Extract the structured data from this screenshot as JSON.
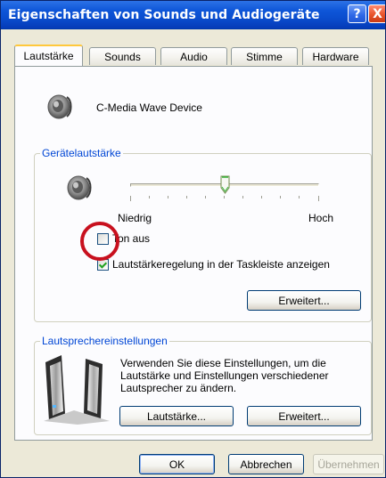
{
  "window": {
    "title": "Eigenschaften von Sounds und Audiogeräte",
    "help_symbol": "?",
    "close_symbol": "X"
  },
  "tabs": [
    {
      "label": "Lautstärke",
      "selected": true
    },
    {
      "label": "Sounds",
      "selected": false
    },
    {
      "label": "Audio",
      "selected": false
    },
    {
      "label": "Stimme",
      "selected": false
    },
    {
      "label": "Hardware",
      "selected": false
    }
  ],
  "device": {
    "name": "C-Media Wave Device",
    "icon": "speaker-icon"
  },
  "device_volume": {
    "group_label": "Gerätelautstärke",
    "slider_value_percent": 50,
    "low_label": "Niedrig",
    "high_label": "Hoch",
    "mute_label": "Ton aus",
    "mute_checked": false,
    "taskbar_label": "Lautstärkeregelung in der Taskleiste anzeigen",
    "taskbar_checked": true,
    "advanced_label": "Erweitert..."
  },
  "speaker_settings": {
    "group_label": "Lautsprechereinstellungen",
    "description_lines": [
      "Verwenden Sie diese Einstellungen, um die",
      "Lautstärke und Einstellungen verschiedener",
      "Lautsprecher zu ändern."
    ],
    "volume_label": "Lautstärke...",
    "advanced_label": "Erweitert..."
  },
  "dialog_buttons": {
    "ok": "OK",
    "cancel": "Abbrechen",
    "apply": "Übernehmen"
  },
  "colors": {
    "titlebar": "#0a4ccd",
    "window": "#ece9d8",
    "panel": "#fcfcfe",
    "group_label": "#0046d5",
    "highlight_circle": "#c8101e",
    "checkbox_check": "#21a121",
    "active_tab_accent": "#ffc83c"
  },
  "icons": {
    "device": "speaker-icon",
    "volume": "speaker-icon",
    "speaker_set": "speaker-set-icon",
    "help": "help-icon",
    "close": "close-icon"
  }
}
